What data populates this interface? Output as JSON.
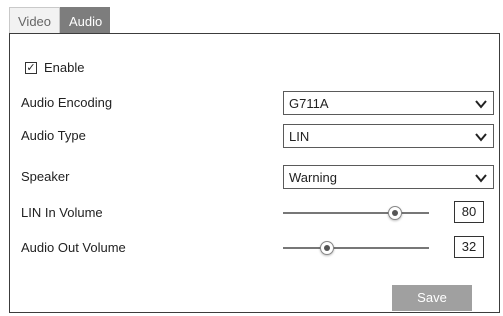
{
  "tabs": [
    {
      "label": "Video",
      "active": false
    },
    {
      "label": "Audio",
      "active": true
    }
  ],
  "enable": {
    "label": "Enable",
    "checked": true,
    "check_glyph": "✓"
  },
  "fields": {
    "audio_encoding": {
      "label": "Audio Encoding",
      "value": "G711A"
    },
    "audio_type": {
      "label": "Audio Type",
      "value": "LIN"
    },
    "speaker": {
      "label": "Speaker",
      "value": "Warning"
    },
    "lin_in_volume": {
      "label": "LIN In Volume",
      "value": "80"
    },
    "audio_out_volume": {
      "label": "Audio Out Volume",
      "value": "32"
    }
  },
  "save_label": "Save",
  "colors": {
    "active_tab": "#7d7d7d",
    "save_button": "#a0a0a0"
  },
  "icons": {
    "dropdown": "chevron-down-icon",
    "checkbox": "checkbox-icon",
    "slider": "slider-knob-icon"
  }
}
